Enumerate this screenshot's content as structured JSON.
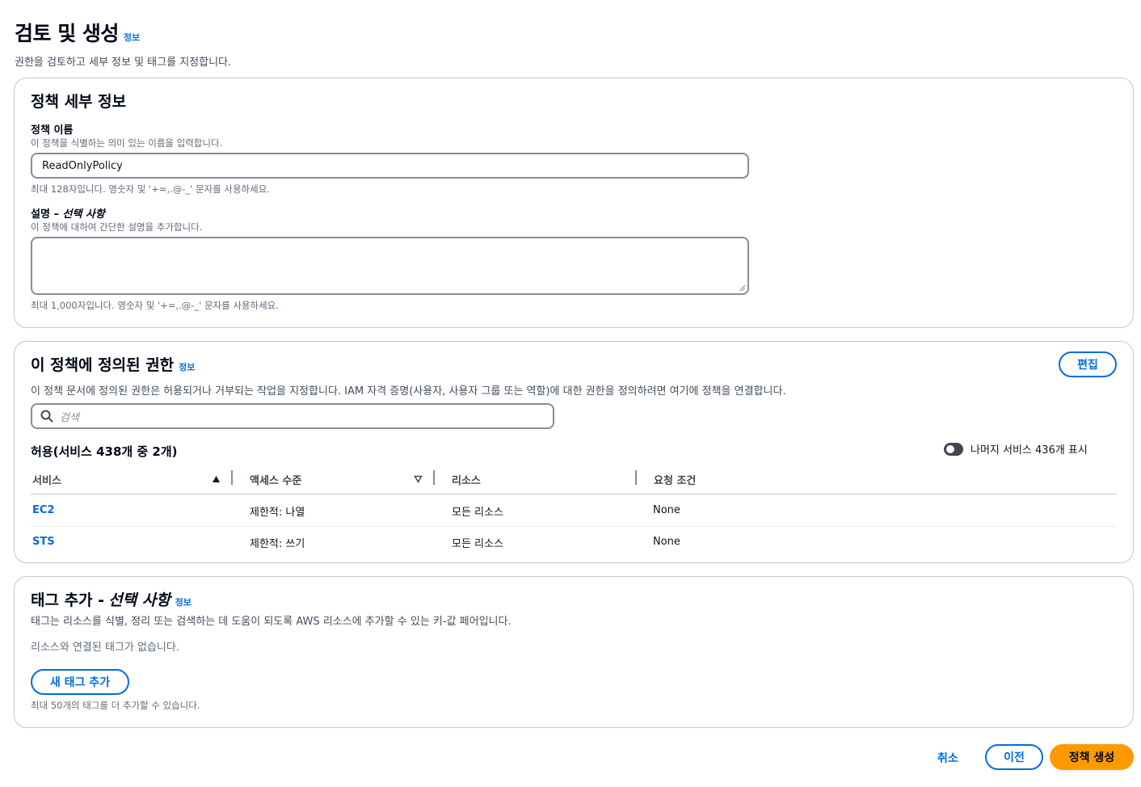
{
  "header": {
    "title": "검토 및 생성",
    "info": "정보",
    "description": "권한을 검토하고 세부 정보 및 태그를 지정합니다."
  },
  "details": {
    "title": "정책 세부 정보",
    "name_label": "정책 이름",
    "name_desc": "이 정책을 식별하는 의미 있는 이름을 입력합니다.",
    "name_value": "ReadOnlyPolicy",
    "name_hint": "최대 128자입니다. 영숫자 및 '+=,.@-_' 문자를 사용하세요.",
    "desc_label": "설명 –",
    "desc_optional": "선택 사항",
    "desc_desc": "이 정책에 대하여 간단한 설명을 추가합니다.",
    "desc_value": "",
    "desc_hint": "최대 1,000자입니다. 영숫자 및 '+=,.@-_' 문자를 사용하세요."
  },
  "permissions": {
    "title": "이 정책에 정의된 권한",
    "info": "정보",
    "edit": "편집",
    "description": "이 정책 문서에 정의된 권한은 허용되거나 거부되는 작업을 지정합니다. IAM 자격 증명(사용자, 사용자 그룹 또는 역할)에 대한 권한을 정의하려면 여기에 정책을 연결합니다.",
    "search_placeholder": "검색",
    "allowed_title": "허용(서비스 438개 중 2개)",
    "toggle_label": "나머지 서비스 436개 표시",
    "columns": [
      "서비스",
      "액세스 수준",
      "리소스",
      "요청 조건"
    ],
    "rows": [
      {
        "service": "EC2",
        "access": "제한적: 나열",
        "resource": "모든 리소스",
        "condition": "None"
      },
      {
        "service": "STS",
        "access": "제한적: 쓰기",
        "resource": "모든 리소스",
        "condition": "None"
      }
    ]
  },
  "tags": {
    "title": "태그 추가 -",
    "optional": "선택 사항",
    "info": "정보",
    "description": "태그는 리소스를 식별, 정리 또는 검색하는 데 도움이 되도록 AWS 리소스에 추가할 수 있는 키-값 페어입니다.",
    "empty": "리소스와 연결된 태그가 없습니다.",
    "add_button": "새 태그 추가",
    "hint": "최대 50개의 태그를 더 추가할 수 있습니다."
  },
  "footer": {
    "cancel": "취소",
    "previous": "이전",
    "create": "정책 생성"
  },
  "colors": {
    "accent": "#006ce0",
    "primary_button": "#ff9900"
  }
}
